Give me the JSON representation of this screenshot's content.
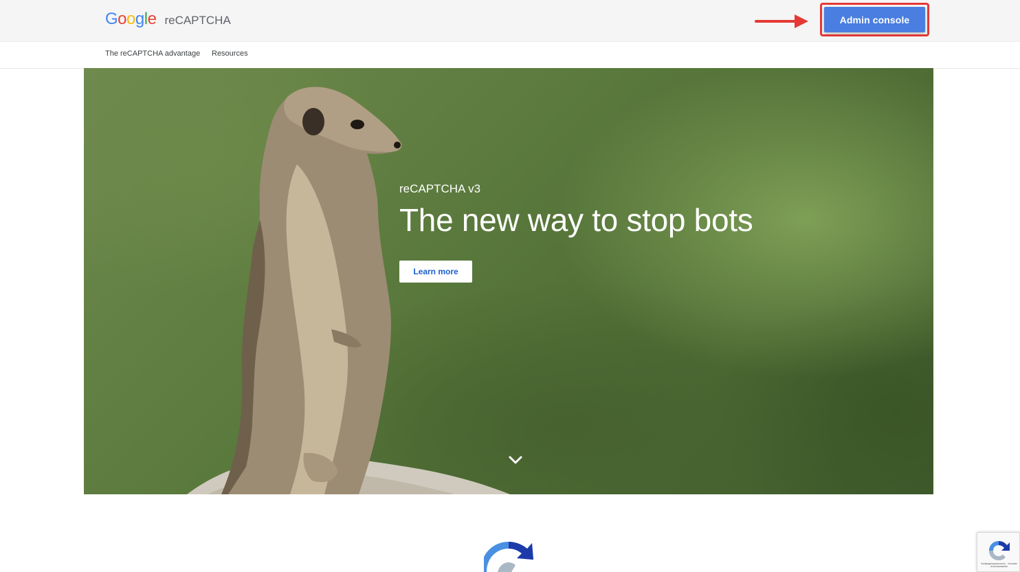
{
  "header": {
    "logo_letters": [
      "G",
      "o",
      "o",
      "g",
      "l",
      "e"
    ],
    "logo_colors": [
      "#4285F4",
      "#EA4335",
      "#FBBC05",
      "#4285F4",
      "#34A853",
      "#EA4335"
    ],
    "product_name": "reCAPTCHA",
    "admin_button_label": "Admin console",
    "admin_button_color": "#4a7ee0",
    "annotation_color": "#e53935"
  },
  "subnav": {
    "items": [
      {
        "label": "The reCAPTCHA advantage"
      },
      {
        "label": "Resources"
      }
    ]
  },
  "hero": {
    "eyebrow": "reCAPTCHA v3",
    "headline": "The new way to stop bots",
    "cta_label": "Learn more",
    "cta_text_color": "#1a5fcc",
    "scroll_icon": "chevron-down-icon"
  },
  "badge": {
    "icon": "recaptcha-logo-icon",
    "text": "Конфиденциальность - Условия использования"
  }
}
